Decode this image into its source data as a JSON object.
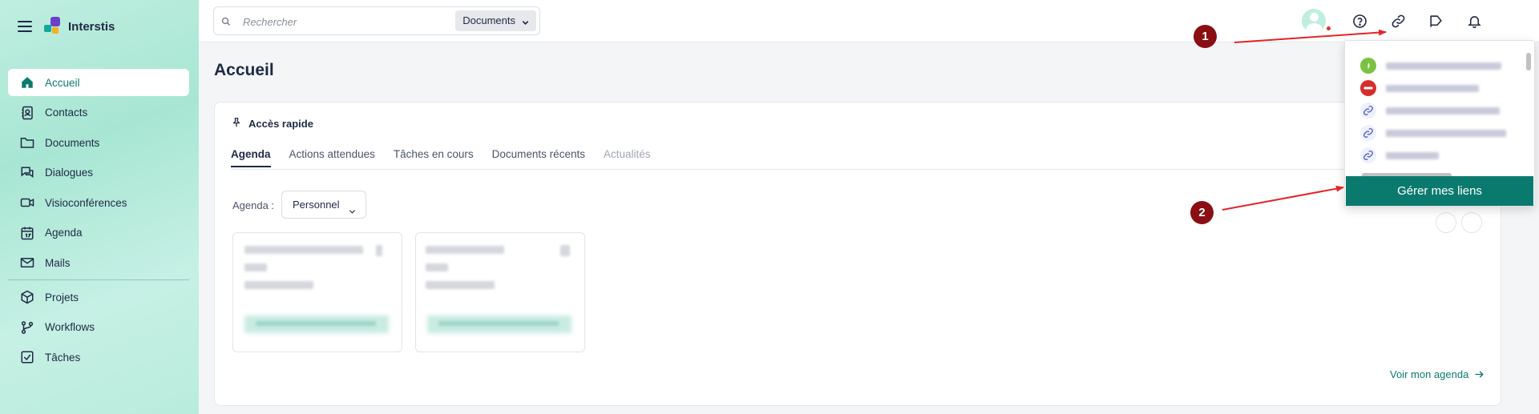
{
  "app": {
    "title": "Interstis"
  },
  "sidebar": {
    "items": [
      {
        "label": "Accueil",
        "icon": "home-icon",
        "active": true
      },
      {
        "label": "Contacts",
        "icon": "contacts-icon"
      },
      {
        "label": "Documents",
        "icon": "folder-icon"
      },
      {
        "label": "Dialogues",
        "icon": "chat-icon"
      },
      {
        "label": "Visioconférences",
        "icon": "video-icon"
      },
      {
        "label": "Agenda",
        "icon": "calendar-icon"
      },
      {
        "label": "Mails",
        "icon": "mail-icon"
      },
      {
        "label": "Projets",
        "icon": "cube-icon"
      },
      {
        "label": "Workflows",
        "icon": "workflow-icon"
      },
      {
        "label": "Tâches",
        "icon": "task-icon"
      }
    ]
  },
  "search": {
    "placeholder": "Rechercher",
    "scope": "Documents"
  },
  "main": {
    "title": "Accueil",
    "quick_access": "Accès rapide",
    "tabs": [
      {
        "label": "Agenda",
        "state": "active"
      },
      {
        "label": "Actions attendues",
        "state": "normal"
      },
      {
        "label": "Tâches en cours",
        "state": "normal"
      },
      {
        "label": "Documents récents",
        "state": "normal"
      },
      {
        "label": "Actualités",
        "state": "disabled"
      }
    ],
    "agenda_label": "Agenda :",
    "agenda_select": "Personnel",
    "see_agenda": "Voir mon agenda"
  },
  "links_dropdown": {
    "manage_label": "Gérer mes liens",
    "item_icons": [
      "green-circle-icon",
      "red-circle-icon",
      "link-icon",
      "link-icon",
      "link-icon"
    ]
  },
  "annotations": {
    "marker_1": "1",
    "marker_2": "2"
  },
  "colors": {
    "accent": "#0b7a6e",
    "marker": "#8b0e13",
    "arrow": "#e5232a",
    "sidebar": "#bfeee0"
  }
}
